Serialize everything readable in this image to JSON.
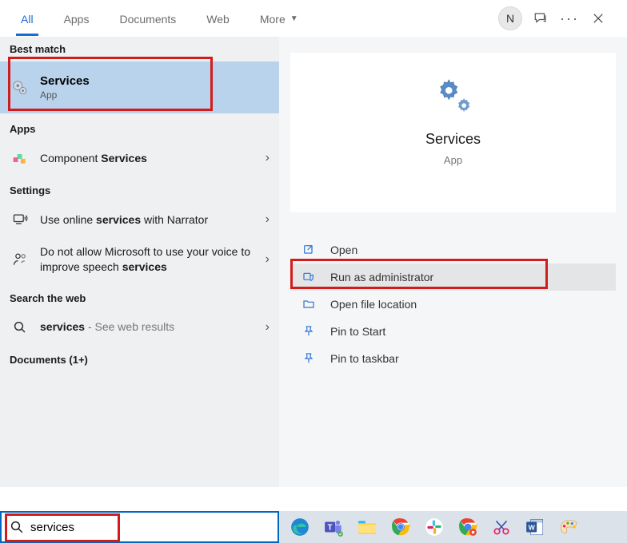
{
  "tabs": {
    "all": "All",
    "apps": "Apps",
    "documents": "Documents",
    "web": "Web",
    "more": "More"
  },
  "header": {
    "avatar_initial": "N"
  },
  "sections": {
    "best_match": "Best match",
    "apps": "Apps",
    "settings": "Settings",
    "search_web": "Search the web",
    "documents": "Documents (1+)"
  },
  "best_match": {
    "title": "Services",
    "subtitle": "App"
  },
  "apps_results": {
    "row0": {
      "prefix": "Component ",
      "bold": "Services"
    }
  },
  "settings_results": {
    "row0": {
      "prefix": "Use online ",
      "bold": "services",
      "suffix": " with Narrator"
    },
    "row1": {
      "prefix": "Do not allow Microsoft to use your voice to improve speech ",
      "bold": "services"
    }
  },
  "web_results": {
    "row0": {
      "bold": "services",
      "muted": " - See web results"
    }
  },
  "preview": {
    "title": "Services",
    "subtitle": "App"
  },
  "actions": {
    "open": "Open",
    "run_admin": "Run as administrator",
    "open_loc": "Open file location",
    "pin_start": "Pin to Start",
    "pin_taskbar": "Pin to taskbar"
  },
  "search": {
    "value": "services"
  }
}
